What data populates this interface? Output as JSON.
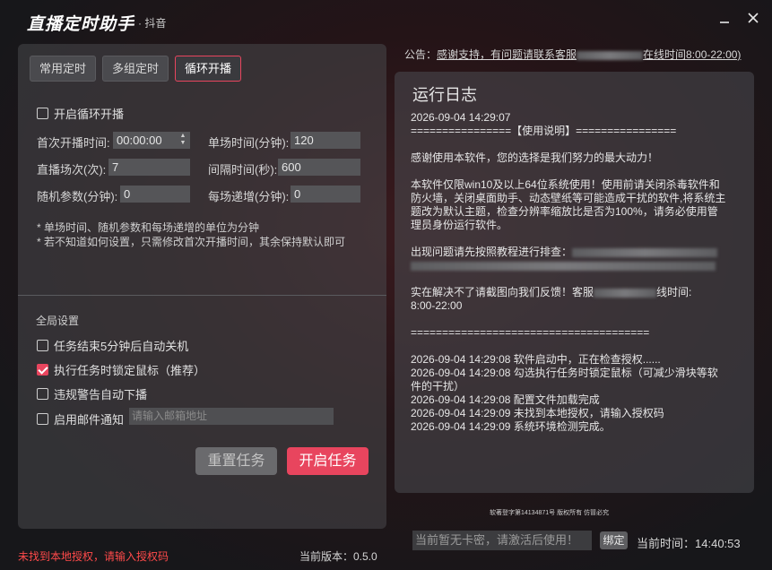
{
  "window": {
    "title": "直播定时助手",
    "subtitle": "· 抖音",
    "minimize_icon": "minimize-icon",
    "close_icon": "close-icon"
  },
  "tabs": [
    {
      "label": "常用定时",
      "active": false
    },
    {
      "label": "多组定时",
      "active": false
    },
    {
      "label": "循环开播",
      "active": true
    }
  ],
  "loop": {
    "enable_label": "开启循环开播",
    "enable_checked": false,
    "fields": {
      "first_start_label": "首次开播时间:",
      "first_start_value": "00:00:00",
      "duration_label": "单场时间(分钟):",
      "duration_value": "120",
      "count_label": "直播场次(次):",
      "count_value": "7",
      "interval_label": "间隔时间(秒):",
      "interval_value": "600",
      "random_label": "随机参数(分钟):",
      "random_value": "0",
      "increment_label": "每场递增(分钟):",
      "increment_value": "0"
    },
    "notes": [
      "* 单场时间、随机参数和每场递增的单位为分钟",
      "* 若不知道如何设置，只需修改首次开播时间，其余保持默认即可"
    ]
  },
  "global": {
    "title": "全局设置",
    "options": [
      {
        "label": "任务结束5分钟后自动关机",
        "checked": false
      },
      {
        "label": "执行任务时锁定鼠标（推荐）",
        "checked": true
      },
      {
        "label": "违规警告自动下播",
        "checked": false
      },
      {
        "label": "启用邮件通知",
        "checked": false
      }
    ],
    "email_placeholder": "请输入邮箱地址"
  },
  "buttons": {
    "reset": "重置任务",
    "start": "开启任务"
  },
  "status": {
    "auth_error": "未找到本地授权，请输入授权码",
    "version": "当前版本：0.5.0"
  },
  "notice": {
    "prefix": "公告：",
    "text_a": "感谢支持，有问题请联系客服",
    "text_b": "在线时间8:00-22:00)"
  },
  "log": {
    "title": "运行日志",
    "lines": [
      "2026-09-04 14:29:07",
      "================【使用说明】================",
      "",
      "感谢使用本软件，您的选择是我们努力的最大动力！",
      "",
      "本软件仅限win10及以上64位系统使用！使用前请关闭杀毒软件和防火墙，关闭桌面助手、动态壁纸等可能造成干扰的软件,将系统主题改为默认主题，检查分辨率缩放比是否为100%，请务必使用管理员身份运行软件。",
      "",
      "出现问题请先按照教程进行排查：",
      "",
      "",
      "实在解决不了请截图向我们反馈！客服",
      "8:00-22:00",
      "",
      "======================================",
      "",
      "2026-09-04 14:29:08 软件启动中，正在检查授权......",
      "2026-09-04 14:29:08 勾选执行任务时锁定鼠标（可减少滑块等软件的干扰）",
      "2026-09-04 14:29:08 配置文件加载完成",
      "2026-09-04 14:29:09 未找到本地授权，请输入授权码",
      "2026-09-04 14:29:09 系统环境检测完成。"
    ],
    "feedback_suffix": "线时间:"
  },
  "copyright": "软著登字第14134871号 版权所有 仿冒必究",
  "card": {
    "placeholder": "当前暂无卡密，请激活后使用！",
    "bind_label": "绑定"
  },
  "clock": {
    "label": "当前时间：",
    "value": "14:40:53"
  },
  "colors": {
    "accent": "#e8455e",
    "error": "#ff4a4a"
  }
}
